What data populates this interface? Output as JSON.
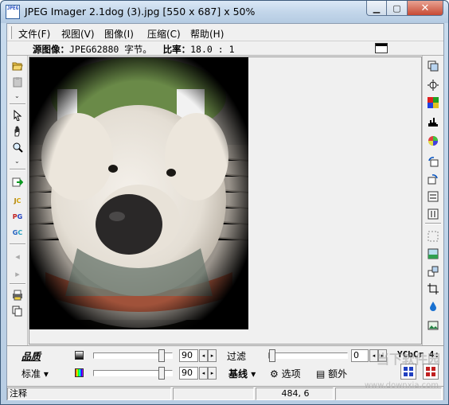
{
  "window": {
    "title": "JPEG Imager 2.1dog (3).jpg [550 x 687] x 50%",
    "icon_text": "JPEG"
  },
  "menu": {
    "items": [
      "文件(F)",
      "视图(V)",
      "图像(I)",
      "压缩(C)",
      "帮助(H)"
    ]
  },
  "info": {
    "source_label": "源图像：",
    "source_value": "JPEG62880 字节。",
    "ratio_label": "比率：",
    "ratio_value": "18.0 : 1"
  },
  "left_toolbar": {
    "icons": [
      "open-folder-icon",
      "paste-icon",
      "chevron-down-icon",
      "pointer-icon",
      "hand-icon",
      "zoom-icon",
      "chevron-down-icon",
      "export-icon",
      "jpeg-jc-icon",
      "jpeg-pg-icon",
      "jpeg-gc-icon",
      "previous-icon",
      "next-icon",
      "print-icon",
      "copy-icon"
    ]
  },
  "right_toolbar": {
    "icons": [
      "duplicate-icon",
      "brightness-icon",
      "color-grid-icon",
      "histogram-icon",
      "color-wheel-icon",
      "rotate-left-icon",
      "rotate-right-icon",
      "flip-horizontal-icon",
      "flip-vertical-icon",
      "selection-icon",
      "image-enhance-icon",
      "resize-icon",
      "crop-icon",
      "water-drop-icon",
      "image-view-icon"
    ]
  },
  "bottom": {
    "quality_label": "品质",
    "standard_label": "标准",
    "standard_dropdown": "▾",
    "luma_value": "90",
    "chroma_value": "90",
    "filter_label": "过滤",
    "filter_value": "0",
    "baseline_label": "基线",
    "baseline_dropdown": "▾",
    "options_label": "选项",
    "extra_label": "额外",
    "ycbcr_label": "YCbCr 4:",
    "luma_level": 0.9,
    "chroma_level": 0.9,
    "filter_level": 0
  },
  "status": {
    "note": "注释",
    "cell2": "",
    "coords": "484, 6",
    "cell4": ""
  },
  "watermark": {
    "text": "当下软件园",
    "url": "www.downxia.com"
  },
  "colors": {
    "close_button": "#c74a34",
    "title_gradient_top": "#dbe8f6"
  }
}
